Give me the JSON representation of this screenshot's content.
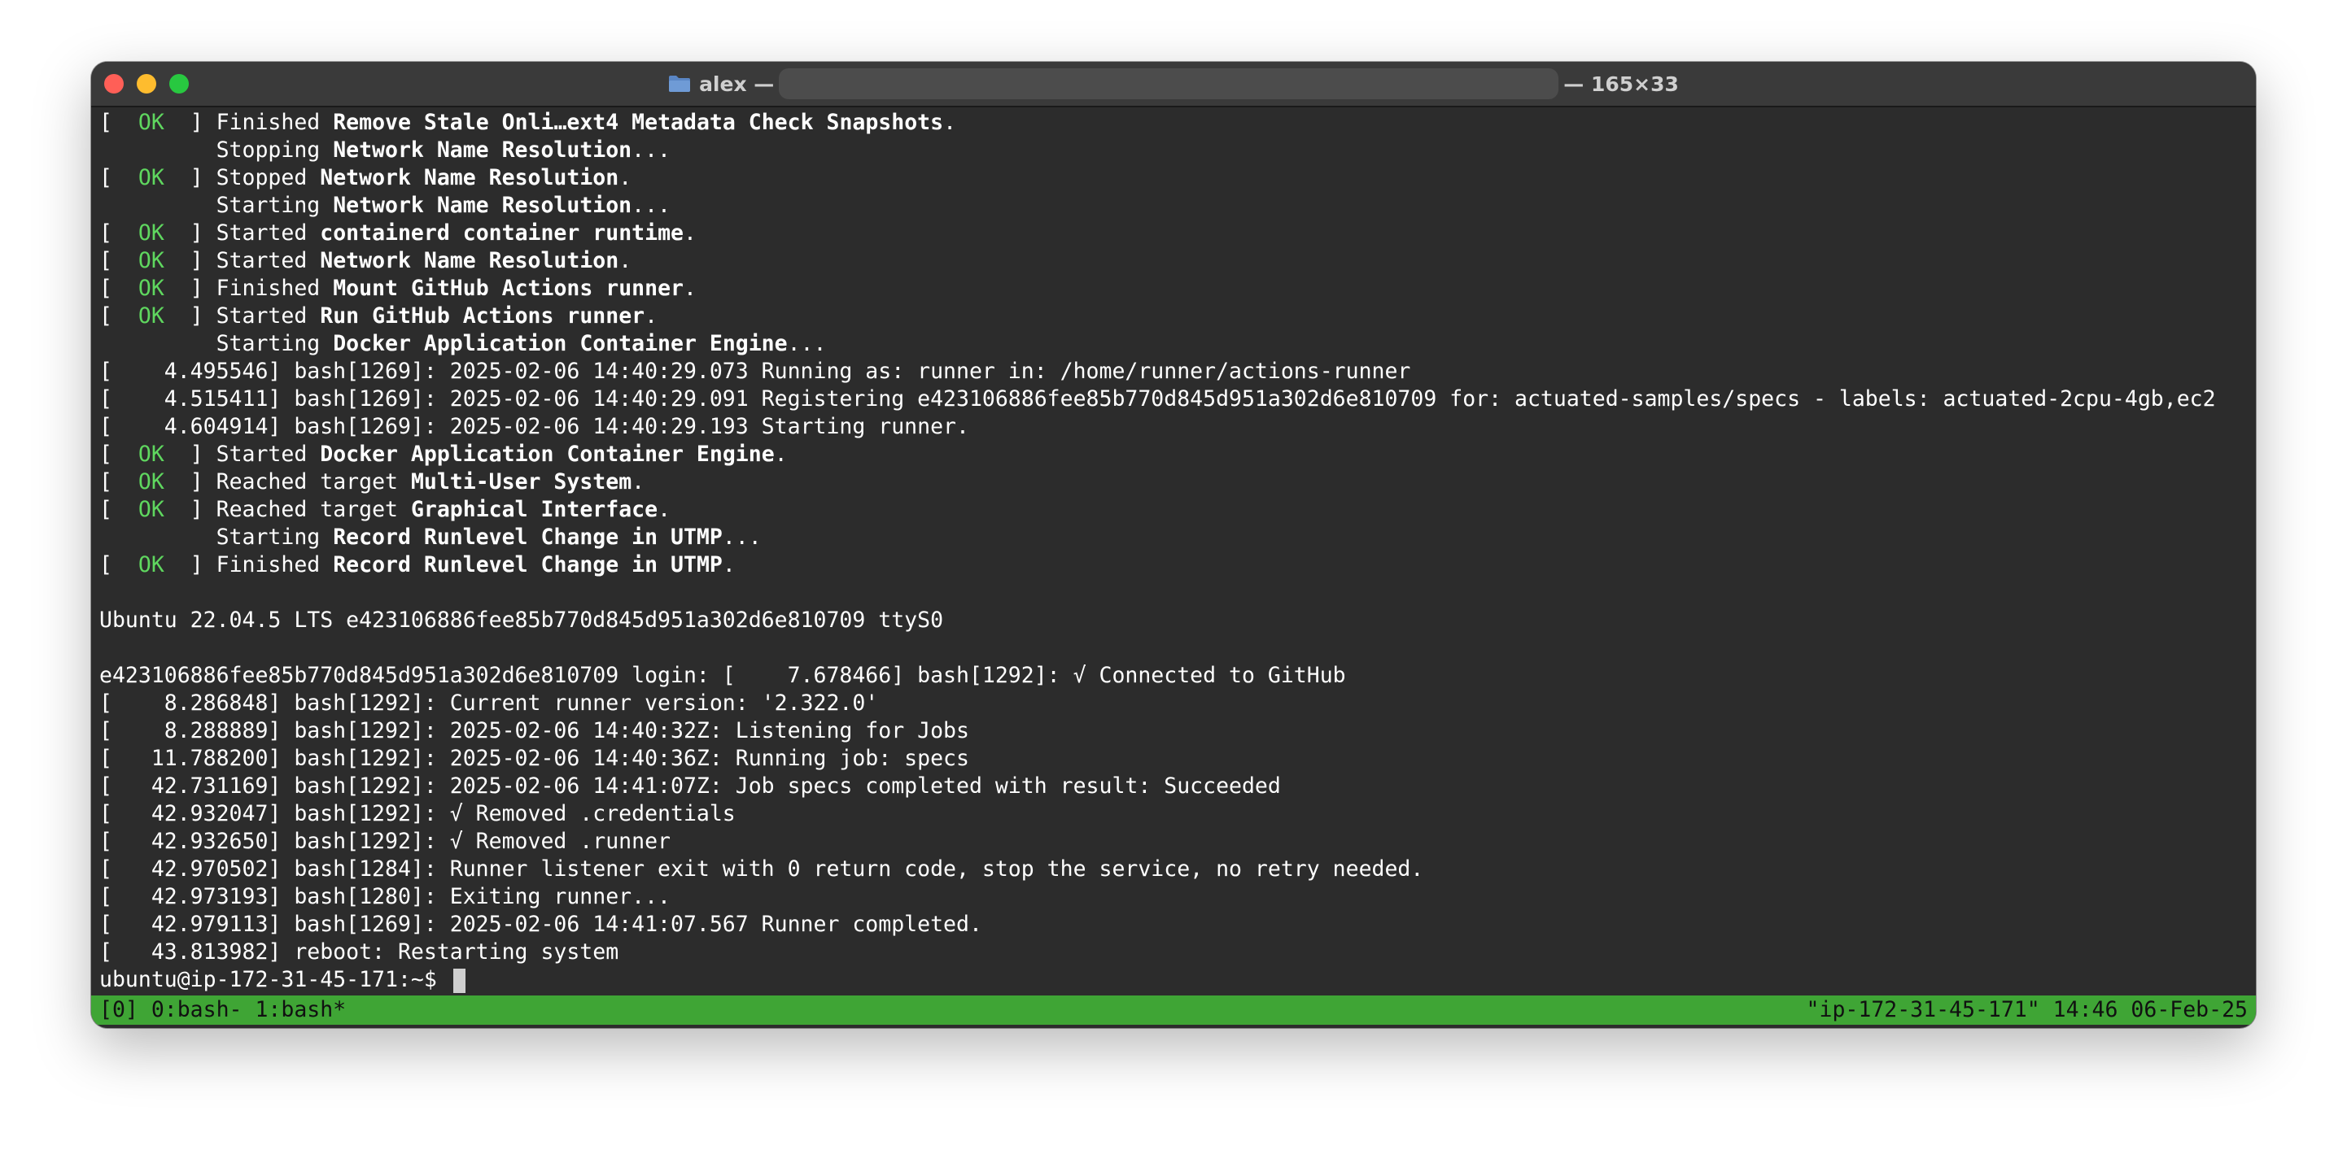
{
  "window": {
    "title_user": "alex —",
    "title_size": "— 165×33"
  },
  "terminal": {
    "lines": [
      {
        "pre": "[  ",
        "ok": "OK",
        "post": "  ] Finished ",
        "bold": "Remove Stale Onli…ext4 Metadata Check Snapshots",
        "tail": "."
      },
      {
        "pre": "         Stopping ",
        "bold": "Network Name Resolution",
        "tail": "..."
      },
      {
        "pre": "[  ",
        "ok": "OK",
        "post": "  ] Stopped ",
        "bold": "Network Name Resolution",
        "tail": "."
      },
      {
        "pre": "         Starting ",
        "bold": "Network Name Resolution",
        "tail": "..."
      },
      {
        "pre": "[  ",
        "ok": "OK",
        "post": "  ] Started ",
        "bold": "containerd container runtime",
        "tail": "."
      },
      {
        "pre": "[  ",
        "ok": "OK",
        "post": "  ] Started ",
        "bold": "Network Name Resolution",
        "tail": "."
      },
      {
        "pre": "[  ",
        "ok": "OK",
        "post": "  ] Finished ",
        "bold": "Mount GitHub Actions runner",
        "tail": "."
      },
      {
        "pre": "[  ",
        "ok": "OK",
        "post": "  ] Started ",
        "bold": "Run GitHub Actions runner",
        "tail": "."
      },
      {
        "pre": "         Starting ",
        "bold": "Docker Application Container Engine",
        "tail": "..."
      },
      {
        "pre": "[    4.495546] bash[1269]: 2025-02-06 14:40:29.073 Running as: runner in: /home/runner/actions-runner"
      },
      {
        "pre": "[    4.515411] bash[1269]: 2025-02-06 14:40:29.091 Registering e423106886fee85b770d845d951a302d6e810709 for: actuated-samples/specs - labels: actuated-2cpu-4gb,ec2"
      },
      {
        "pre": "[    4.604914] bash[1269]: 2025-02-06 14:40:29.193 Starting runner."
      },
      {
        "pre": "[  ",
        "ok": "OK",
        "post": "  ] Started ",
        "bold": "Docker Application Container Engine",
        "tail": "."
      },
      {
        "pre": "[  ",
        "ok": "OK",
        "post": "  ] Reached target ",
        "bold": "Multi-User System",
        "tail": "."
      },
      {
        "pre": "[  ",
        "ok": "OK",
        "post": "  ] Reached target ",
        "bold": "Graphical Interface",
        "tail": "."
      },
      {
        "pre": "         Starting ",
        "bold": "Record Runlevel Change in UTMP",
        "tail": "..."
      },
      {
        "pre": "[  ",
        "ok": "OK",
        "post": "  ] Finished ",
        "bold": "Record Runlevel Change in UTMP",
        "tail": "."
      },
      {
        "pre": ""
      },
      {
        "pre": "Ubuntu 22.04.5 LTS e423106886fee85b770d845d951a302d6e810709 ttyS0"
      },
      {
        "pre": ""
      },
      {
        "pre": "e423106886fee85b770d845d951a302d6e810709 login: [    7.678466] bash[1292]: √ Connected to GitHub"
      },
      {
        "pre": "[    8.286848] bash[1292]: Current runner version: '2.322.0'"
      },
      {
        "pre": "[    8.288889] bash[1292]: 2025-02-06 14:40:32Z: Listening for Jobs"
      },
      {
        "pre": "[   11.788200] bash[1292]: 2025-02-06 14:40:36Z: Running job: specs"
      },
      {
        "pre": "[   42.731169] bash[1292]: 2025-02-06 14:41:07Z: Job specs completed with result: Succeeded"
      },
      {
        "pre": "[   42.932047] bash[1292]: √ Removed .credentials"
      },
      {
        "pre": "[   42.932650] bash[1292]: √ Removed .runner"
      },
      {
        "pre": "[   42.970502] bash[1284]: Runner listener exit with 0 return code, stop the service, no retry needed."
      },
      {
        "pre": "[   42.973193] bash[1280]: Exiting runner..."
      },
      {
        "pre": "[   42.979113] bash[1269]: 2025-02-06 14:41:07.567 Runner completed."
      },
      {
        "pre": "[   43.813982] reboot: Restarting system"
      }
    ],
    "prompt": "ubuntu@ip-172-31-45-171:~$ "
  },
  "tmux": {
    "left": "[0] 0:bash- 1:bash*",
    "right": "\"ip-172-31-45-171\" 14:46 06-Feb-25"
  },
  "colors": {
    "ok": "#5fd75f",
    "status_bar": "#3fa535",
    "terminal_bg": "#2c2c2c"
  }
}
